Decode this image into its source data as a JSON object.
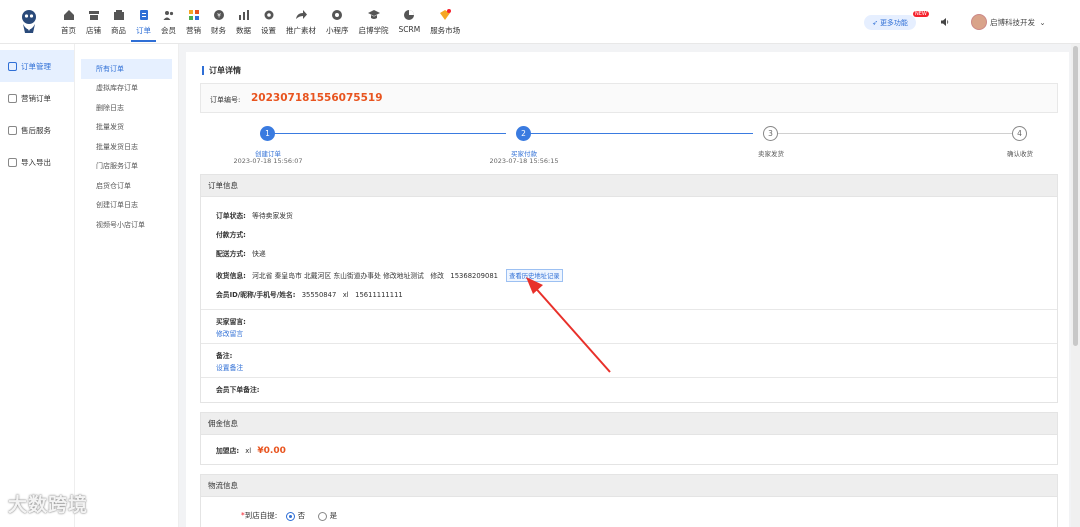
{
  "colors": {
    "accent": "#2f6fd6",
    "price": "#e8541f",
    "arrow": "#e8302a"
  },
  "nav": {
    "items": [
      {
        "label": "首页",
        "icon": "home-icon"
      },
      {
        "label": "店铺",
        "icon": "store-icon"
      },
      {
        "label": "商品",
        "icon": "goods-icon"
      },
      {
        "label": "订单",
        "icon": "order-icon",
        "active": true
      },
      {
        "label": "会员",
        "icon": "member-icon"
      },
      {
        "label": "营销",
        "icon": "marketing-icon"
      },
      {
        "label": "财务",
        "icon": "finance-icon"
      },
      {
        "label": "数据",
        "icon": "data-icon"
      },
      {
        "label": "设置",
        "icon": "settings-icon"
      },
      {
        "label": "推广素材",
        "icon": "share-icon"
      },
      {
        "label": "小程序",
        "icon": "miniprogram-icon"
      },
      {
        "label": "启博学院",
        "icon": "academy-icon"
      },
      {
        "label": "SCRM",
        "icon": "scrm-icon"
      },
      {
        "label": "服务市场",
        "icon": "market-icon"
      }
    ],
    "more_label": "更多功能",
    "new_badge": "NEW",
    "username": "启博科技开发"
  },
  "sidebar": {
    "primary": [
      {
        "label": "订单管理",
        "active": true
      },
      {
        "label": "营销订单"
      },
      {
        "label": "售后服务"
      },
      {
        "label": "导入导出"
      }
    ],
    "secondary": [
      {
        "label": "所有订单",
        "active": true
      },
      {
        "label": "虚拟库存订单"
      },
      {
        "label": "删除日志"
      },
      {
        "label": "批量发货"
      },
      {
        "label": "批量发货日志"
      },
      {
        "label": "门店服务订单"
      },
      {
        "label": "启货仓订单"
      },
      {
        "label": "创建订单日志"
      },
      {
        "label": "视频号小店订单"
      }
    ]
  },
  "page": {
    "title": "订单详情",
    "order_label": "订单编号:",
    "order_no": "202307181556075519"
  },
  "steps": [
    {
      "num": "1",
      "label": "创建订单",
      "time": "2023-07-18 15:56:07",
      "done": true
    },
    {
      "num": "2",
      "label": "买家付款",
      "time": "2023-07-18 15:56:15",
      "done": true
    },
    {
      "num": "3",
      "label": "卖家发货",
      "time": "",
      "done": false
    },
    {
      "num": "4",
      "label": "确认收货",
      "time": "",
      "done": false
    }
  ],
  "order_info": {
    "heading": "订单信息",
    "status_label": "订单状态:",
    "status_value": "等待卖家发货",
    "pay_label": "付款方式:",
    "pay_value": "",
    "delivery_label": "配送方式:",
    "delivery_value": "快递",
    "address_label": "收货信息:",
    "address_value": "河北省 秦皇岛市 北戴河区 东山街道办事处 修改地址测试   修改   15368209081",
    "history_button": "查看历史地址记录",
    "member_label": "会员ID/昵称/手机号/姓名:",
    "member_value": "35550847   xl   15611111111",
    "buyer_msg_label": "买家留言:",
    "buyer_msg_link": "修改留言",
    "note_label": "备注:",
    "note_link": "设置备注",
    "member_note_label": "会员下单备注:"
  },
  "commission": {
    "heading": "佣金信息",
    "label": "加盟店:",
    "name": "xl",
    "amount": "¥0.00"
  },
  "logistics": {
    "heading": "物流信息",
    "pickup_label": "到店自提:",
    "option_no": "否",
    "option_yes": "是",
    "selected": "否"
  },
  "watermark": "大数跨境"
}
